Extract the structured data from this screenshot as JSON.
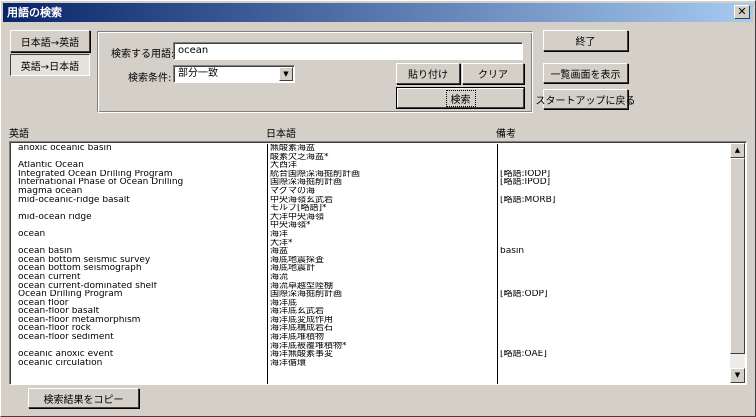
{
  "window": {
    "title": "用語の検索",
    "close_glyph": "✕"
  },
  "language_buttons": {
    "ja_en": "日本語→英語",
    "en_ja": "英語→日本語"
  },
  "search": {
    "term_label": "検索する用語:",
    "term_value": "ocean",
    "condition_label": "検索条件:",
    "condition_value": "部分一致",
    "paste_label": "貼り付け",
    "clear_label": "クリア",
    "search_label": "検索"
  },
  "side_buttons": {
    "exit_label": "終了",
    "list_label": "一覧画面を表示",
    "startup_label": "スタートアップに戻る"
  },
  "columns": {
    "english": "英語",
    "japanese": "日本語",
    "notes": "備考"
  },
  "results": {
    "english": [
      "anoxic oceanic basin",
      "",
      "Atlantic Ocean",
      "Integrated Ocean Drilling Program",
      "International Phase of Ocean Drilling",
      "magma ocean",
      "mid-oceanic-ridge basalt",
      "",
      "mid-ocean ridge",
      "",
      "ocean",
      "",
      "ocean basin",
      "ocean bottom seismic survey",
      "ocean bottom seismograph",
      "ocean current",
      "ocean current-dominated shelf",
      "Ocean Drilling Program",
      "ocean floor",
      "ocean-floor basalt",
      "ocean-floor metamorphism",
      "ocean-floor rock",
      "ocean-floor sediment",
      "",
      "oceanic anoxic event",
      "oceanic circulation"
    ],
    "japanese": [
      "無酸素海盆",
      "酸素欠乏海盆*",
      "大西洋",
      "統合国際深海掘削計画",
      "国際深海掘削計画",
      "マグマの海",
      "中央海嶺玄武岩",
      "モルブ[略語]*",
      "大洋中央海嶺",
      "中央海嶺*",
      "海洋",
      "大洋*",
      "海盆",
      "海底地震探査",
      "海底地震計",
      "海流",
      "海流卓越型陸棚",
      "国際深海掘削計画",
      "海洋底",
      "海洋底玄武岩",
      "海洋底変成作用",
      "海洋底構成岩石",
      "海洋底堆積物",
      "海洋底被覆堆積物*",
      "海洋無酸素事変",
      "海洋循環"
    ],
    "notes": [
      "",
      "",
      "",
      "[略語:IODP]",
      "[略語:IPOD]",
      "",
      "[略語:MORB]",
      "",
      "",
      "",
      "",
      "",
      "basin",
      "",
      "",
      "",
      "",
      "[略語:ODP]",
      "",
      "",
      "",
      "",
      "",
      "",
      "[略語:OAE]",
      ""
    ]
  },
  "scroll": {
    "up_glyph": "▲",
    "down_glyph": "▼"
  },
  "copy_button": {
    "label": "検索結果をコピー"
  }
}
